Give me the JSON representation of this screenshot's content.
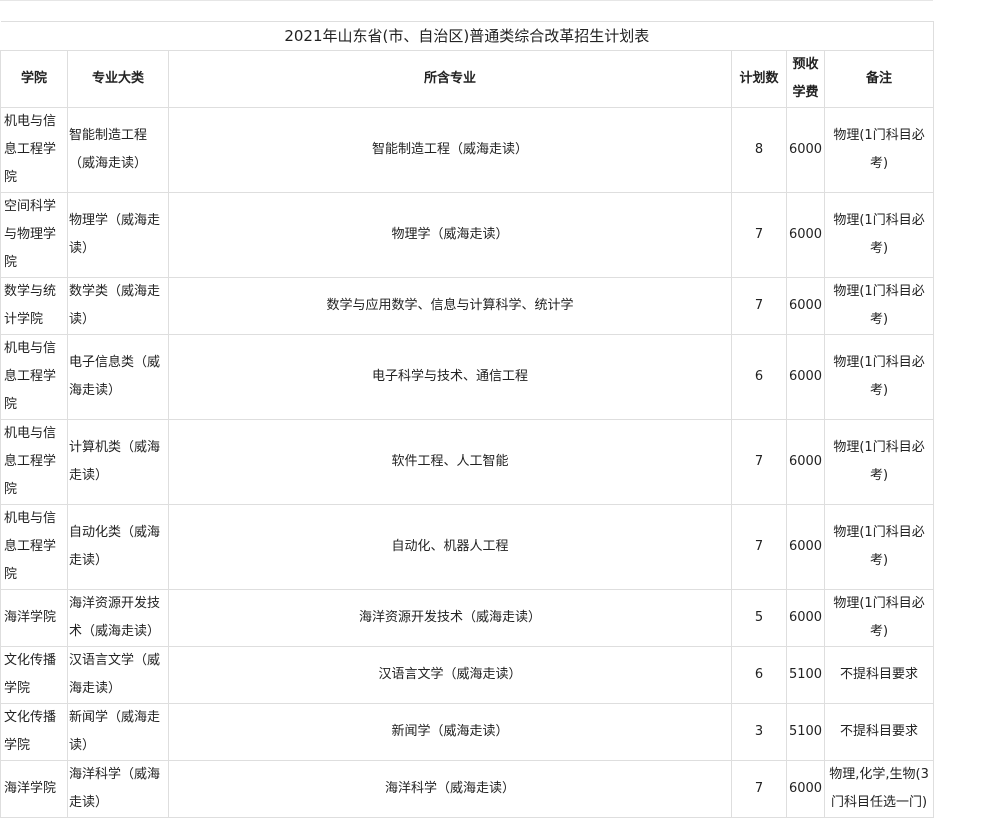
{
  "table": {
    "title": "2021年山东省(市、自治区)普通类综合改革招生计划表",
    "headers": {
      "college": "学院",
      "category": "专业大类",
      "majors": "所含专业",
      "plan": "计划数",
      "fee": "预收学费",
      "note": "备注"
    },
    "rows": [
      {
        "college": "机电与信息工程学院",
        "category": "智能制造工程（威海走读）",
        "majors": "智能制造工程（威海走读）",
        "plan": "8",
        "fee": "6000",
        "note": "物理(1门科目必考)"
      },
      {
        "college": "空间科学与物理学院",
        "category": "物理学（威海走读）",
        "majors": "物理学（威海走读）",
        "plan": "7",
        "fee": "6000",
        "note": "物理(1门科目必考)"
      },
      {
        "college": "数学与统计学院",
        "category": "数学类（威海走读）",
        "majors": "数学与应用数学、信息与计算科学、统计学",
        "plan": "7",
        "fee": "6000",
        "note": "物理(1门科目必考)"
      },
      {
        "college": "机电与信息工程学院",
        "category": "电子信息类（威海走读）",
        "majors": "电子科学与技术、通信工程",
        "plan": "6",
        "fee": "6000",
        "note": "物理(1门科目必考)"
      },
      {
        "college": "机电与信息工程学院",
        "category": "计算机类（威海走读）",
        "majors": "软件工程、人工智能",
        "plan": "7",
        "fee": "6000",
        "note": "物理(1门科目必考)"
      },
      {
        "college": "机电与信息工程学院",
        "category": "自动化类（威海走读）",
        "majors": "自动化、机器人工程",
        "plan": "7",
        "fee": "6000",
        "note": "物理(1门科目必考)"
      },
      {
        "college": "海洋学院",
        "category": "海洋资源开发技术（威海走读）",
        "majors": "海洋资源开发技术（威海走读）",
        "plan": "5",
        "fee": "6000",
        "note": "物理(1门科目必考)"
      },
      {
        "college": "文化传播学院",
        "category": "汉语言文学（威海走读）",
        "majors": "汉语言文学（威海走读）",
        "plan": "6",
        "fee": "5100",
        "note": "不提科目要求"
      },
      {
        "college": "文化传播学院",
        "category": "新闻学（威海走读）",
        "majors": "新闻学（威海走读）",
        "plan": "3",
        "fee": "5100",
        "note": "不提科目要求"
      },
      {
        "college": "海洋学院",
        "category": "海洋科学（威海走读）",
        "majors": "海洋科学（威海走读）",
        "plan": "7",
        "fee": "6000",
        "note": "物理,化学,生物(3门科目任选一门)"
      }
    ]
  }
}
